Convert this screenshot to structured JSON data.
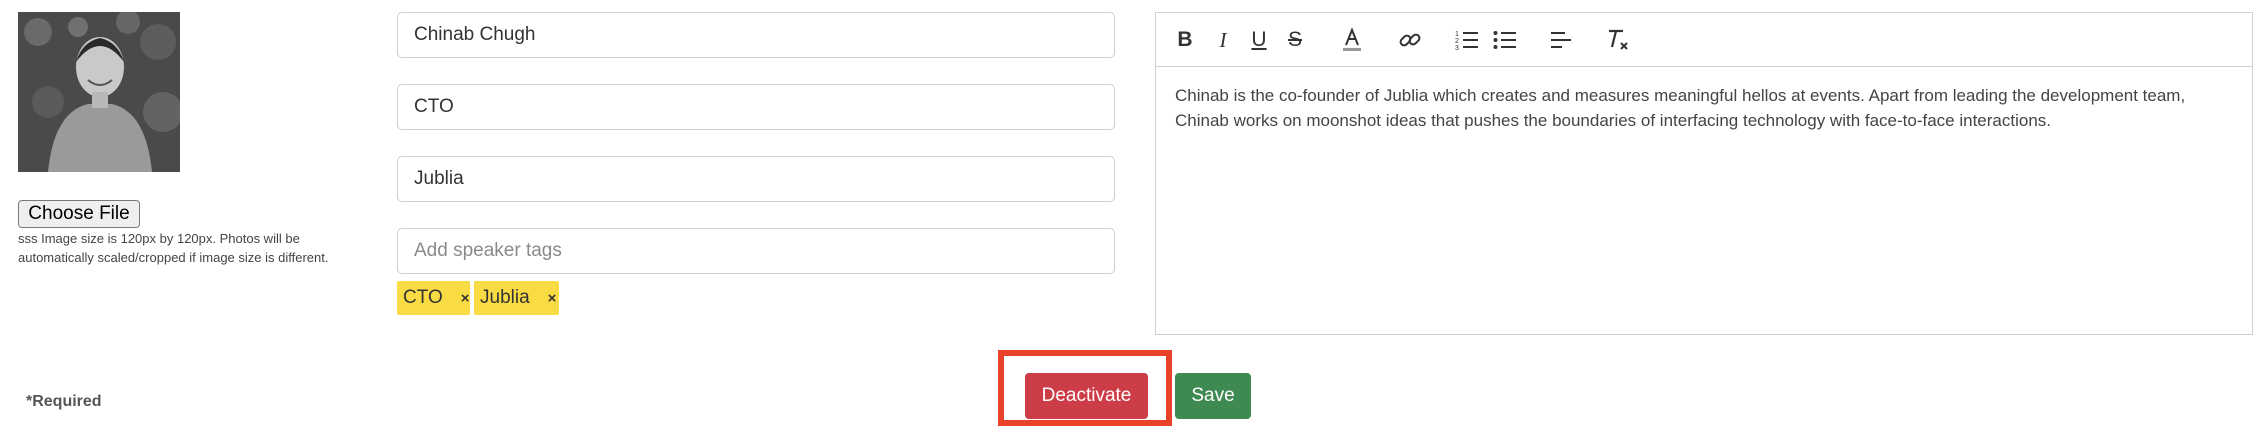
{
  "photo": {
    "alt": "speaker-photo"
  },
  "upload": {
    "button_label": "Choose File",
    "hint_line1": "sss Image size is 120px by 120px. Photos will be",
    "hint_line2": "automatically scaled/cropped if image size is different."
  },
  "form": {
    "name_value": "Chinab Chugh",
    "title_value": "CTO",
    "company_value": "Jublia",
    "tags_placeholder": "Add speaker tags",
    "tags": [
      {
        "label": "CTO",
        "remove": "×"
      },
      {
        "label": "Jublia",
        "remove": "×"
      }
    ],
    "required_note": "*Required"
  },
  "editor": {
    "toolbar": [
      "bold-icon",
      "italic-icon",
      "underline-icon",
      "strikethrough-icon",
      "text-color-icon",
      "link-icon",
      "ordered-list-icon",
      "bullet-list-icon",
      "align-icon",
      "clear-format-icon"
    ],
    "body_line1": "Chinab is the co-founder of Jublia which creates and measures meaningful hellos at events. Apart from leading the development team,",
    "body_line2": "Chinab works on moonshot ideas that pushes the boundaries of interfacing technology with face-to-face interactions."
  },
  "actions": {
    "deactivate_label": "Deactivate",
    "save_label": "Save",
    "highlight_color": "#e8432a",
    "deactivate_color": "#cc3d48",
    "save_color": "#3f8a52"
  },
  "colors": {
    "tag_bg": "#f9dc44"
  }
}
